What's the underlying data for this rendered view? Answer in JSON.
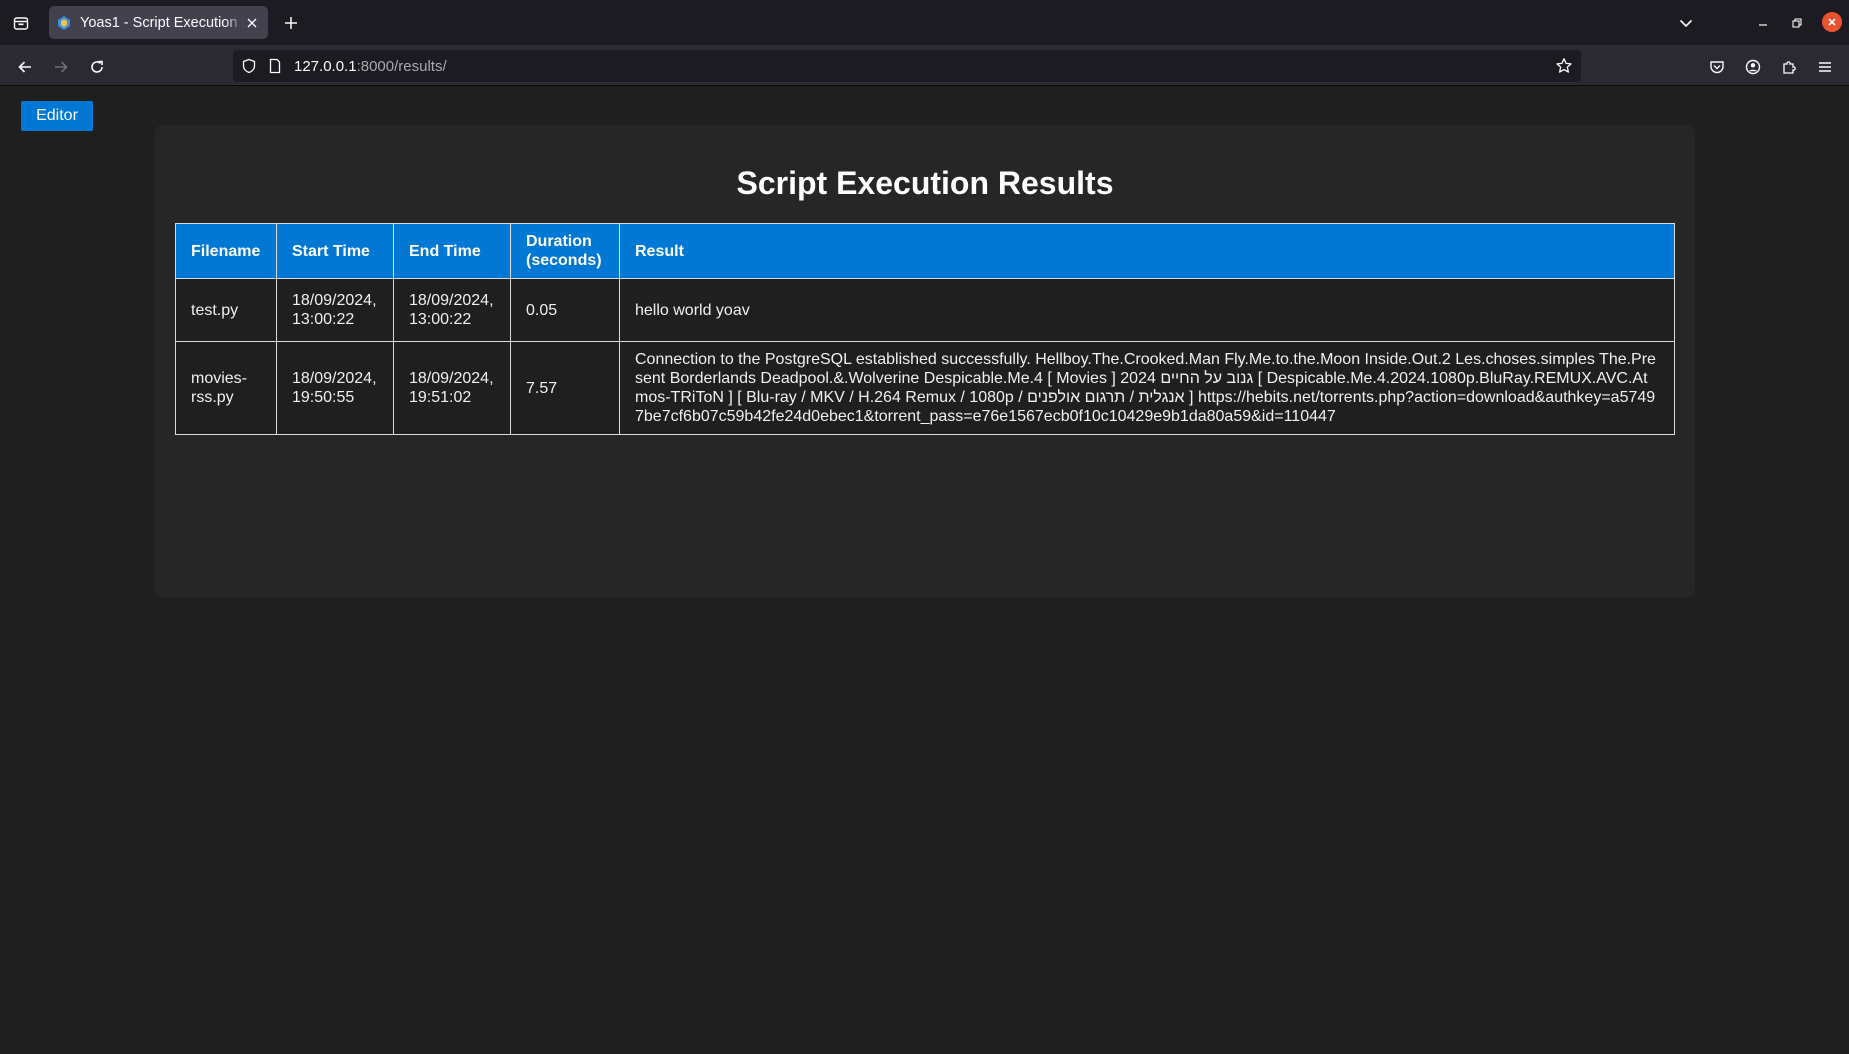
{
  "browser": {
    "tab_title": "Yoas1 - Script Execution Results",
    "url_host": "127.0.0.1",
    "url_rest": ":8000/results/"
  },
  "page": {
    "editor_button": "Editor",
    "heading": "Script Execution Results",
    "table": {
      "headers": {
        "filename": "Filename",
        "start_time": "Start Time",
        "end_time": "End Time",
        "duration": "Duration (seconds)",
        "result": "Result"
      },
      "rows": [
        {
          "filename": "test.py",
          "start_time": "18/09/2024, 13:00:22",
          "end_time": "18/09/2024, 13:00:22",
          "duration": "0.05",
          "result": "hello world yoav"
        },
        {
          "filename": "movies-rss.py",
          "start_time": "18/09/2024, 19:50:55",
          "end_time": "18/09/2024, 19:51:02",
          "duration": "7.57",
          "result": "Connection to the PostgreSQL established successfully. Hellboy.The.Crooked.Man Fly.Me.to.the.Moon Inside.Out.2 Les.choses.simples The.Present Borderlands Deadpool.&.Wolverine Despicable.Me.4 [ Movies ] 2024 גנוב על החיים [ Despicable.Me.4.2024.1080p.BluRay.REMUX.AVC.Atmos-TRiToN ] [ Blu-ray / MKV / H.264 Remux / 1080p / אנגלית / תרגום אולפנים ] https://hebits.net/torrents.php?action=download&authkey=a57497be7cf6b07c59b42fe24d0ebec1&torrent_pass=e76e1567ecb0f10c10429e9b1da80a59&id=110447"
        }
      ]
    }
  },
  "icons": {
    "tab_list": "tab-list-icon",
    "favicon": "favicon-icon",
    "tab_close": "close-icon",
    "new_tab": "plus-icon",
    "list_all_tabs": "chevron-down-icon",
    "minimize": "minimize-icon",
    "restore": "restore-icon",
    "window_close": "close-icon",
    "back": "back-arrow-icon",
    "forward": "forward-arrow-icon",
    "reload": "reload-icon",
    "shield": "shield-icon",
    "page": "page-icon",
    "bookmark": "star-icon",
    "pocket": "pocket-icon",
    "account": "account-icon",
    "extensions": "puzzle-icon",
    "menu": "hamburger-icon"
  },
  "colors": {
    "accent": "#0078d4",
    "page_bg": "#1f1f1f",
    "card_bg": "#262626",
    "close_button": "#e9542e"
  }
}
